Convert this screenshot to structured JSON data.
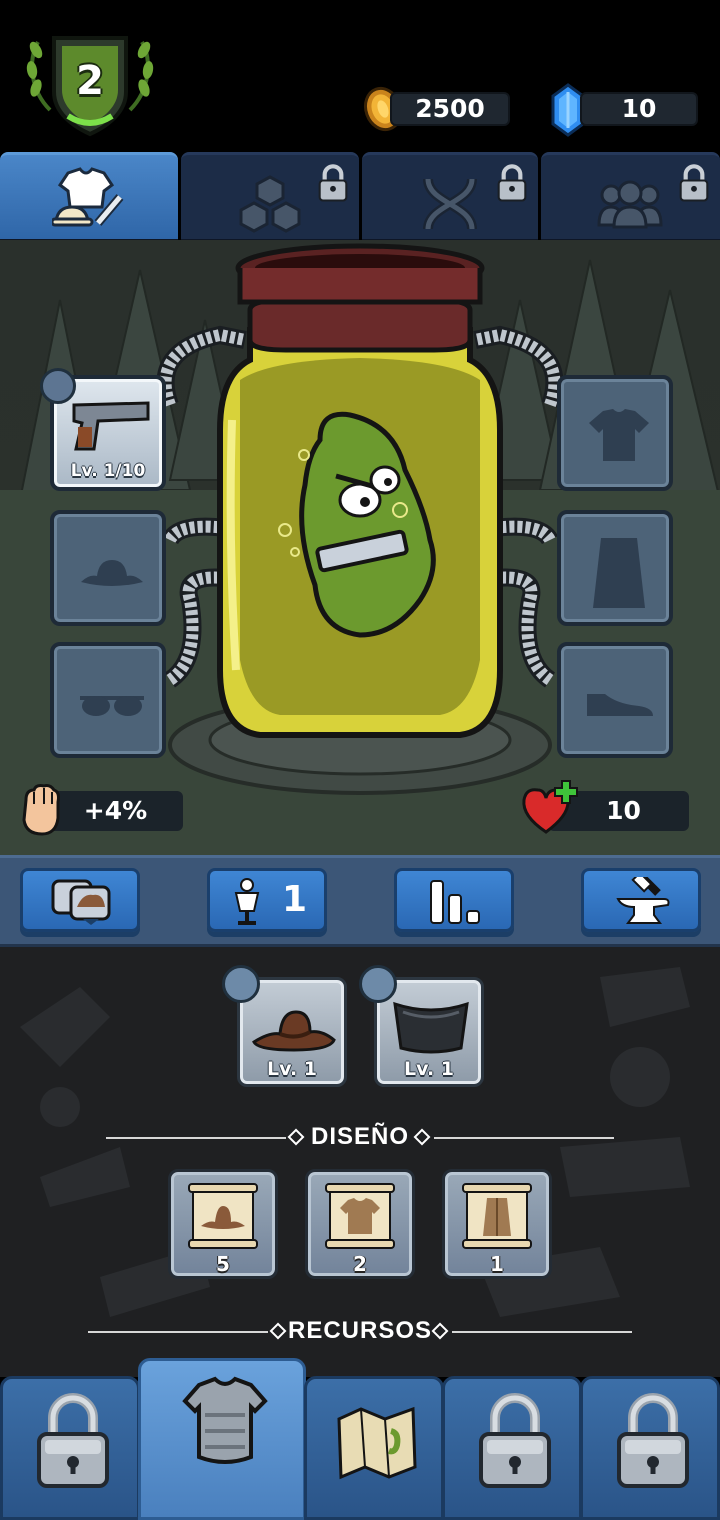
{
  "player": {
    "level": "2"
  },
  "currency": {
    "coins": "2500",
    "gems": "10"
  },
  "tabs": [
    {
      "name": "equipment",
      "active": true,
      "locked": false
    },
    {
      "name": "hexagons",
      "active": false,
      "locked": true
    },
    {
      "name": "dna",
      "active": false,
      "locked": true
    },
    {
      "name": "group",
      "active": false,
      "locked": true
    }
  ],
  "equipment": {
    "weapon": {
      "level_label": "Lv. 1/10",
      "icon": "pistol-icon"
    },
    "empty_slots": [
      "shirt-icon",
      "hat-icon",
      "coat-icon",
      "glasses-icon",
      "shoe-icon"
    ]
  },
  "stats": {
    "attack_bonus": "+4%",
    "health": "10"
  },
  "toolbar": {
    "figure_count": "1"
  },
  "inventory": [
    {
      "level_label": "Lv. 1",
      "icon": "cowboy-hat-icon",
      "badge": "hat-icon"
    },
    {
      "level_label": "Lv. 1",
      "icon": "dark-vest-icon",
      "badge": "shirt-icon"
    }
  ],
  "design": {
    "title": "DISEÑO",
    "items": [
      {
        "icon": "hat-icon",
        "count": "5"
      },
      {
        "icon": "shirt-icon",
        "count": "2"
      },
      {
        "icon": "coat-icon",
        "count": "1"
      }
    ]
  },
  "resources": {
    "title": "RECURSOS"
  },
  "bottom_nav": [
    {
      "name": "locked-1",
      "locked": true
    },
    {
      "name": "armor",
      "active": true
    },
    {
      "name": "map",
      "locked": false
    },
    {
      "name": "locked-2",
      "locked": true
    },
    {
      "name": "locked-3",
      "locked": true
    }
  ],
  "colors": {
    "accent_blue": "#3f86d4",
    "jar_yellow": "#e8e04a",
    "pickle_green": "#6c9a2e",
    "heart_red": "#d92a2a"
  }
}
